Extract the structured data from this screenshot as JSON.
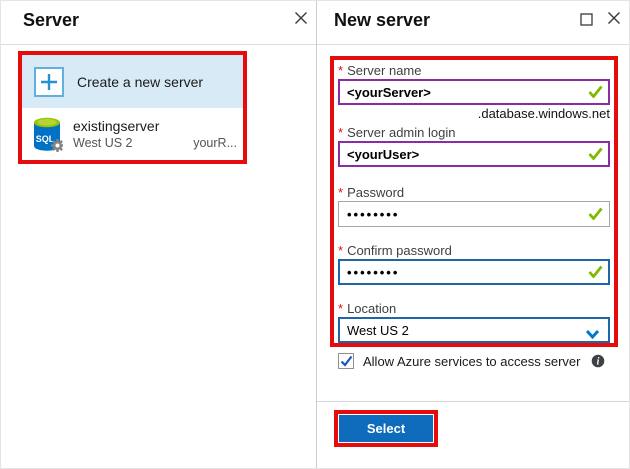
{
  "colors": {
    "annotation": "#e60c0c",
    "accent": "#0f6cbd",
    "edited_border": "#8a2da5",
    "focus_border": "#1e66a8",
    "input_border": "#a6a6a6",
    "valid": "#7fba00",
    "selected_bg": "#d9eaf7",
    "plus_blue": "#2492d1",
    "plus_border": "#62b0de",
    "chevron": "#0078d4",
    "check_blue": "#1a55c0",
    "sql_body": "#0072c6",
    "sql_top": "#94c606",
    "sql_top_light": "#b8d432",
    "gear": "#848484",
    "divider": "#d6d6d6",
    "panel_border": "#cccccc"
  },
  "left_panel": {
    "title": "Server",
    "create_item": {
      "label": "Create a new server"
    },
    "existing_item": {
      "name": "existingserver",
      "location": "West US 2",
      "resource_group": "yourR..."
    }
  },
  "right_panel": {
    "title": "New server",
    "required_marker": "*",
    "form": {
      "server_name": {
        "label": "Server name",
        "value": "<yourServer>",
        "suffix": ".database.windows.net"
      },
      "admin_login": {
        "label": "Server admin login",
        "value": "<yourUser>"
      },
      "password": {
        "label": "Password",
        "value": "••••••••"
      },
      "confirm_password": {
        "label": "Confirm password",
        "value": "••••••••"
      },
      "location": {
        "label": "Location",
        "value": "West US 2"
      }
    },
    "allow_access_checkbox": {
      "label": "Allow Azure services to access server",
      "checked": true
    },
    "select_button_label": "Select"
  }
}
